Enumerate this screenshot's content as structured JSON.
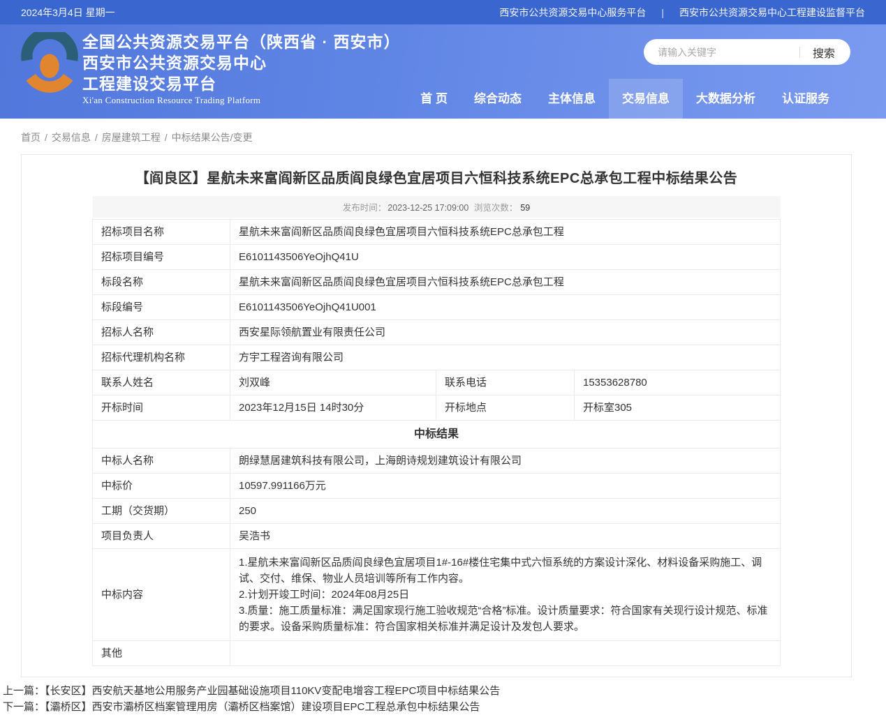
{
  "colors": {
    "topbar_bg": "#3a66cf",
    "header_gradient_start": "#5277dc",
    "header_gradient_end": "#7b9bf0",
    "logo_teal": "#2b5f78",
    "logo_orange": "#e1862e",
    "meta_bg": "#f6f6f6",
    "table_border": "#ebebeb"
  },
  "topbar": {
    "date": "2024年3月4日 星期一",
    "link_service": "西安市公共资源交易中心服务平台",
    "separator": "|",
    "link_supervision": "西安市公共资源交易中心工程建设监督平台"
  },
  "header": {
    "title_line1": "全国公共资源交易平台（陕西省 · 西安市）",
    "title_line2": "西安市公共资源交易中心",
    "title_line3": "工程建设交易平台",
    "title_en": "Xi'an Construction Resource Trading Platform",
    "search": {
      "placeholder": "请输入关键字",
      "button_label": "搜索"
    },
    "nav": [
      {
        "label": "首 页",
        "active": false
      },
      {
        "label": "综合动态",
        "active": false
      },
      {
        "label": "主体信息",
        "active": false
      },
      {
        "label": "交易信息",
        "active": true
      },
      {
        "label": "大数据分析",
        "active": false
      },
      {
        "label": "认证服务",
        "active": false
      }
    ]
  },
  "breadcrumb": {
    "items": [
      "首页",
      "交易信息",
      "房屋建筑工程",
      "中标结果公告/变更"
    ],
    "separator": "/"
  },
  "article": {
    "title": "【阎良区】星航未来富阎新区品质阎良绿色宜居项目六恒科技系统EPC总承包工程中标结果公告",
    "meta": {
      "publish_label": "发布时间：",
      "publish_time": "2023-12-25 17:09:00",
      "views_label": "浏览次数：",
      "views": "59"
    }
  },
  "table": {
    "rows": [
      {
        "type": "single",
        "label": "招标项目名称",
        "value": "星航未来富阎新区品质阎良绿色宜居项目六恒科技系统EPC总承包工程"
      },
      {
        "type": "single",
        "label": "招标项目编号",
        "value": "E6101143506YeOjhQ41U"
      },
      {
        "type": "single",
        "label": "标段名称",
        "value": "星航未来富阎新区品质阎良绿色宜居项目六恒科技系统EPC总承包工程"
      },
      {
        "type": "single",
        "label": "标段编号",
        "value": "E6101143506YeOjhQ41U001"
      },
      {
        "type": "single",
        "label": "招标人名称",
        "value": "西安星际领航置业有限责任公司"
      },
      {
        "type": "single",
        "label": "招标代理机构名称",
        "value": "方宇工程咨询有限公司"
      },
      {
        "type": "double",
        "label": "联系人姓名",
        "value": "刘双峰",
        "label2": "联系电话",
        "value2": "15353628780"
      },
      {
        "type": "double",
        "label": "开标时间",
        "value": "2023年12月15日 14时30分",
        "label2": "开标地点",
        "value2": "开标室305"
      },
      {
        "type": "section",
        "label": "中标结果"
      },
      {
        "type": "single",
        "label": "中标人名称",
        "value": "朗绿慧居建筑科技有限公司，上海朗诗规划建筑设计有限公司"
      },
      {
        "type": "single",
        "label": "中标价",
        "value": "10597.991166万元"
      },
      {
        "type": "single",
        "label": "工期（交货期）",
        "value": "250"
      },
      {
        "type": "single",
        "label": "项目负责人",
        "value": "吴浩书"
      },
      {
        "type": "multiline",
        "label": "中标内容",
        "lines": [
          "1.星航未来富阎新区品质阎良绿色宜居项目1#-16#楼住宅集中式六恒系统的方案设计深化、材料设备采购施工、调试、交付、维保、物业人员培训等所有工作内容。",
          "2.计划开竣工时间：2024年08月25日",
          "3.质量：施工质量标准：满足国家现行施工验收规范“合格”标准。设计质量要求：符合国家有关现行设计规范、标准的要求。设备采购质量标准：符合国家相关标准并满足设计及发包人要求。"
        ]
      },
      {
        "type": "single",
        "label": "其他",
        "value": ""
      }
    ]
  },
  "pager": {
    "prev_label": "上一篇：",
    "prev_text": "【长安区】西安航天基地公用服务产业园基础设施项目110KV变配电增容工程EPC项目中标结果公告",
    "next_label": "下一篇：",
    "next_text": "【灞桥区】西安市灞桥区档案管理用房（灞桥区档案馆）建设项目EPC工程总承包中标结果公告"
  }
}
